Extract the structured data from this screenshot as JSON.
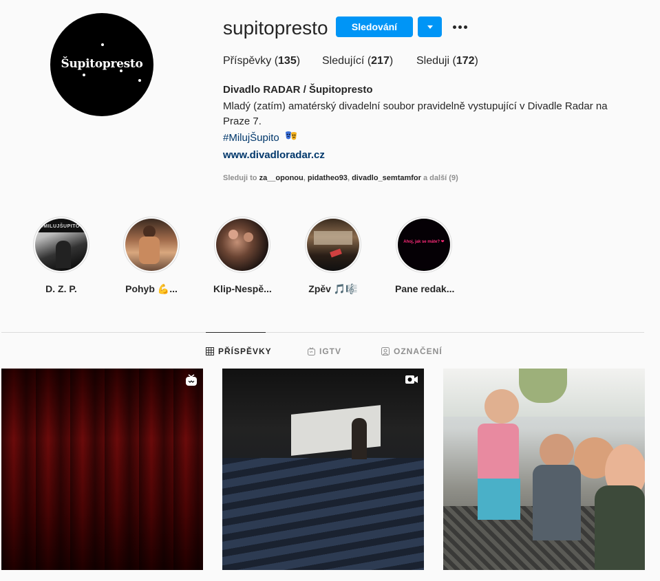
{
  "profile": {
    "avatar_text": "Šupitopresto",
    "username": "supitopresto",
    "follow_label": "Sledování",
    "stats": {
      "posts_label": "Příspěvky",
      "posts_count": "135",
      "followers_label": "Sledující",
      "followers_count": "217",
      "following_label": "Sleduji",
      "following_count": "172"
    },
    "bio": {
      "name": "Divadlo RADAR / Šupitopresto",
      "text": "Mladý (zatím) amatérský divadelní soubor pravidelně vystupující v Divadle Radar na Praze 7.",
      "hashtag": "#MilujŠupito",
      "hashtag_emoji": "performing-arts-emoji",
      "link": "www.divadloradar.cz"
    },
    "followed_by": {
      "prefix": "Sleduji to",
      "user1": "za__oponou",
      "user2": "pidatheo93",
      "user3": "divadlo_semtamfor",
      "suffix": "a další (9)"
    }
  },
  "highlights": [
    {
      "label": "D. Z. P."
    },
    {
      "label": "Pohyb 💪..."
    },
    {
      "label": "Klip-Nespě..."
    },
    {
      "label": "Zpěv 🎵🎼"
    },
    {
      "label": "Pane redak..."
    }
  ],
  "highlight_image_text": {
    "h1_sign": "#MILUJŠUPITO",
    "h5_text": "Ahoj, jak se máte? ❤"
  },
  "tabs": {
    "posts": "PŘÍSPĚVKY",
    "igtv": "IGTV",
    "tagged": "OZNAČENÍ"
  },
  "posts": [
    {
      "badge": "igtv-icon"
    },
    {
      "badge": "video-icon"
    },
    {
      "badge": null
    }
  ],
  "colors": {
    "primary_button": "#0095f6",
    "link": "#00376b",
    "muted": "#8e8e8e",
    "text": "#262626"
  }
}
